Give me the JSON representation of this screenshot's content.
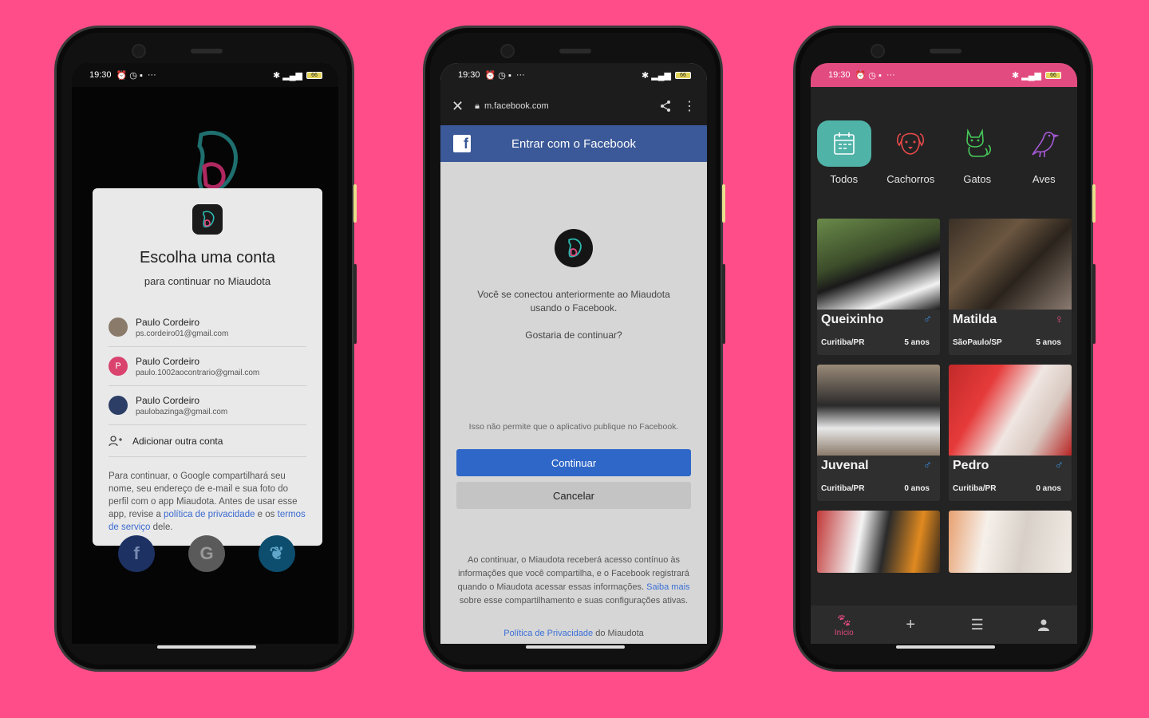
{
  "status": {
    "time": "19:30",
    "dots": "···",
    "battery": "66"
  },
  "google": {
    "title": "Escolha uma conta",
    "subtitle": "para continuar no Miaudota",
    "accounts": [
      {
        "name": "Paulo Cordeiro",
        "email": "ps.cordeiro01@gmail.com",
        "initial": "",
        "color": "#8a7a6a"
      },
      {
        "name": "Paulo Cordeiro",
        "email": "paulo.1002aocontrario@gmail.com",
        "initial": "P",
        "color": "#d9436e"
      },
      {
        "name": "Paulo Cordeiro",
        "email": "paulobazinga@gmail.com",
        "initial": "",
        "color": "#2c3e66"
      }
    ],
    "add_account": "Adicionar outra conta",
    "footer_pre": "Para continuar, o Google compartilhará seu nome, seu endereço de e-mail e sua foto do perfil com o app Miaudota. Antes de usar esse app, revise a ",
    "privacy_link": "política de privacidade",
    "footer_mid": " e os ",
    "terms_link": "termos de serviço",
    "footer_end": " dele.",
    "social": {
      "facebook": "f",
      "google": "G",
      "twitter": "❦"
    }
  },
  "facebook": {
    "url": "m.facebook.com",
    "header": "Entrar com o Facebook",
    "logo_letter": "f",
    "message": "Você se conectou anteriormente ao Miaudota usando o Facebook.",
    "question": "Gostaria de continuar?",
    "no_post": "Isso não permite que o aplicativo publique no Facebook.",
    "continue": "Continuar",
    "cancel": "Cancelar",
    "legal": "Ao continuar, o Miaudota receberá acesso contínuo às informações que você compartilha, e o Facebook registrará quando o Miaudota acessar essas informações. ",
    "learn_more": "Saiba mais",
    "legal_end": " sobre esse compartilhamento e suas configurações ativas.",
    "privacy_link": "Política de Privacidade",
    "privacy_suffix": " do Miaudota"
  },
  "app": {
    "categories": [
      {
        "label": "Todos",
        "icon": "calendar-icon",
        "color": "#4fb3a8"
      },
      {
        "label": "Cachorros",
        "icon": "dog-icon",
        "color": "#e84a4a"
      },
      {
        "label": "Gatos",
        "icon": "cat-icon",
        "color": "#47c95a"
      },
      {
        "label": "Aves",
        "icon": "bird-icon",
        "color": "#a65ad8"
      }
    ],
    "pets": [
      {
        "name": "Queixinho",
        "city": "Curitiba/PR",
        "age": "5 anos",
        "sex": "♂",
        "sex_color": "#3b8fe0"
      },
      {
        "name": "Matilda",
        "city": "SãoPaulo/SP",
        "age": "5 anos",
        "sex": "♀",
        "sex_color": "#e24b80"
      },
      {
        "name": "Juvenal",
        "city": "Curitiba/PR",
        "age": "0 anos",
        "sex": "♂",
        "sex_color": "#3b8fe0"
      },
      {
        "name": "Pedro",
        "city": "Curitiba/PR",
        "age": "0 anos",
        "sex": "♂",
        "sex_color": "#3b8fe0"
      }
    ],
    "nav": {
      "home": "Início",
      "add": "+",
      "list": "☰",
      "profile": "●"
    },
    "accent": "#e24b80"
  }
}
